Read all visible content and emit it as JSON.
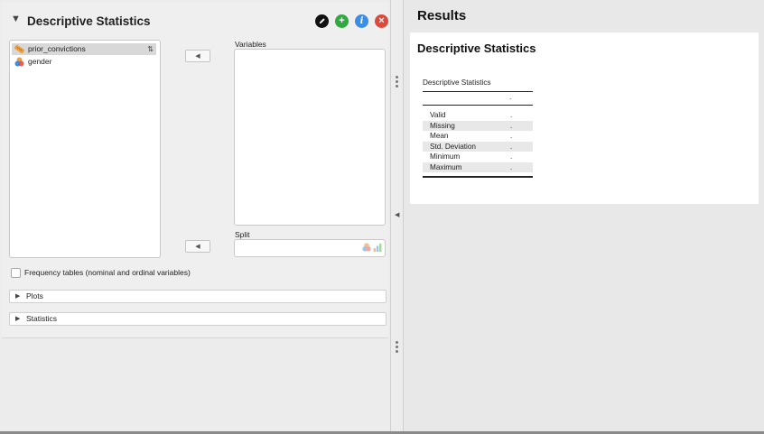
{
  "analysis": {
    "title": "Descriptive Statistics",
    "header_buttons": {
      "edit_icon": "pencil-icon",
      "add_icon": "plus-icon",
      "info_icon": "info-icon",
      "close_icon": "close-icon"
    }
  },
  "source_variables": [
    {
      "label": "prior_convictions",
      "type": "scale",
      "selected": true
    },
    {
      "label": "gender",
      "type": "nominal",
      "selected": false
    }
  ],
  "variables_box": {
    "label": "Variables"
  },
  "split_box": {
    "label": "Split"
  },
  "frequency_tables": {
    "label": "Frequency tables (nominal and ordinal variables)",
    "checked": false
  },
  "sections": {
    "plots": "Plots",
    "statistics": "Statistics"
  },
  "results": {
    "title": "Results",
    "card_title": "Descriptive Statistics",
    "table": {
      "caption": "Descriptive Statistics",
      "column_header": ".",
      "rows": [
        {
          "name": "Valid",
          "value": "."
        },
        {
          "name": "Missing",
          "value": "."
        },
        {
          "name": "Mean",
          "value": "."
        },
        {
          "name": "Std. Deviation",
          "value": "."
        },
        {
          "name": "Minimum",
          "value": "."
        },
        {
          "name": "Maximum",
          "value": "."
        }
      ]
    }
  },
  "colors": {
    "add": "#2eaa3f",
    "info": "#3a8ee6",
    "close": "#e0483a",
    "scale_icon": "#e8a040"
  }
}
